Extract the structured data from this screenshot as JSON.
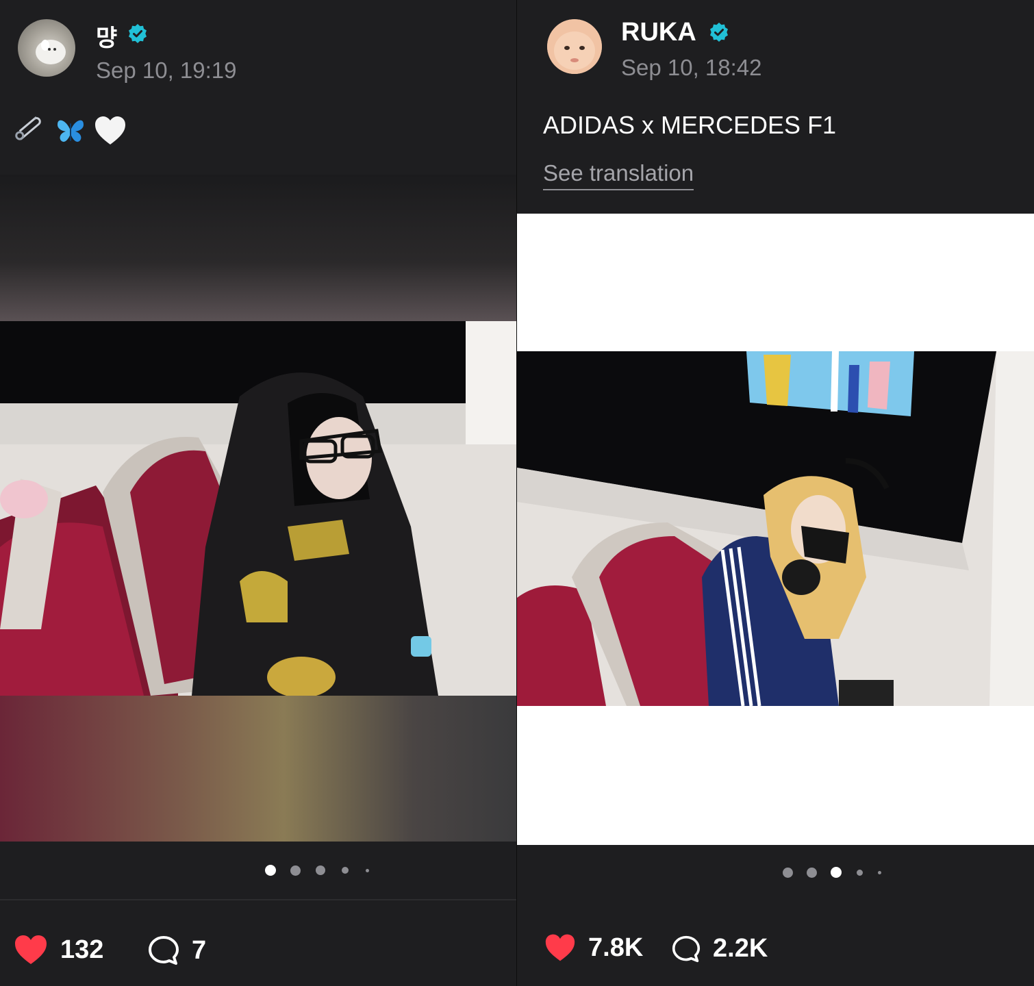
{
  "posts": [
    {
      "username": "먕",
      "verified": true,
      "timestamp": "Sep 10, 19:19",
      "caption_emoji": [
        "safety-pin-icon",
        "butterfly-icon",
        "white-heart-icon"
      ],
      "carousel": {
        "count": 5,
        "active": 1
      },
      "likes": "132",
      "comments": "7"
    },
    {
      "username": "RUKA",
      "verified": true,
      "timestamp": "Sep 10, 18:42",
      "caption": "ADIDAS x MERCEDES F1",
      "see_translation": "See translation",
      "carousel": {
        "count": 5,
        "active": 3
      },
      "likes": "7.8K",
      "comments": "2.2K"
    }
  ],
  "colors": {
    "background": "#1e1e20",
    "verified": "#21c0d6",
    "like": "#ff3b4a",
    "muted_text": "#8e8e93"
  }
}
